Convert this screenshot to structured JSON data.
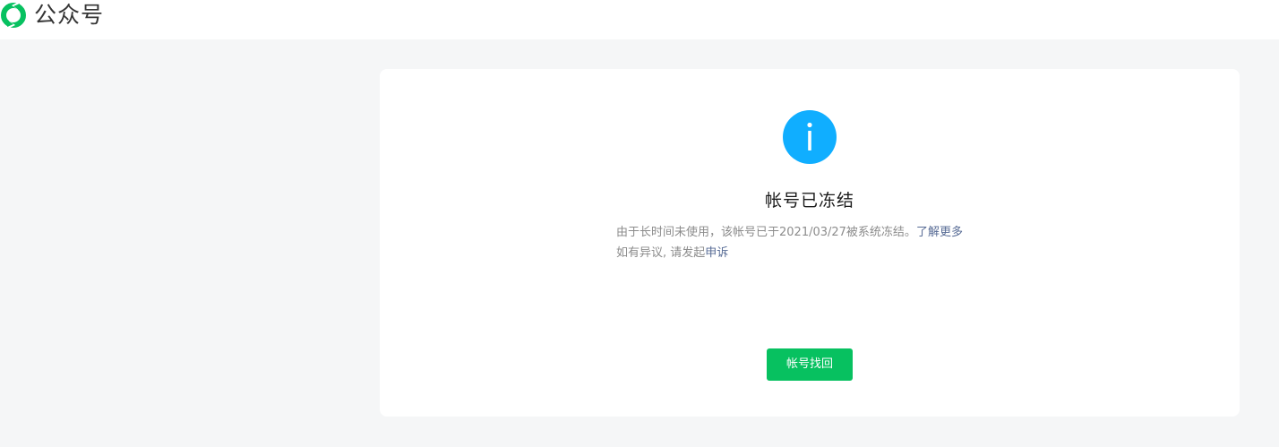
{
  "header": {
    "logo_icon": "wechat-official-account-logo-icon",
    "brand_name": "公众号"
  },
  "notice": {
    "icon": "info-icon",
    "title": "帐号已冻结",
    "line1_text": "由于长时间未使用，该帐号已于2021/03/27被系统冻结。",
    "learn_more_link": "了解更多",
    "line2_text": "如有异议, 请发起",
    "appeal_link": "申诉",
    "recover_button_label": "帐号找回"
  },
  "colors": {
    "page_background": "#f5f6f7",
    "card_background": "#ffffff",
    "info_icon": "#10aeff",
    "primary_button": "#07c160",
    "link": "#576b95",
    "description_text": "#8c8c8c",
    "logo_green": "#07c160"
  }
}
